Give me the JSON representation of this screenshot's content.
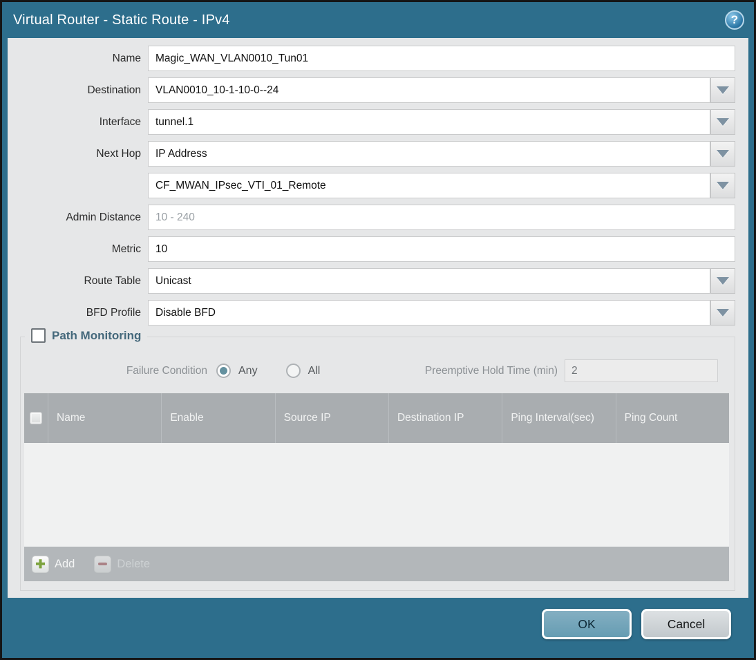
{
  "window": {
    "title": "Virtual Router - Static Route - IPv4",
    "help_glyph": "?"
  },
  "form": {
    "name": {
      "label": "Name",
      "value": "Magic_WAN_VLAN0010_Tun01"
    },
    "destination": {
      "label": "Destination",
      "value": "VLAN0010_10-1-10-0--24"
    },
    "interface": {
      "label": "Interface",
      "value": "tunnel.1"
    },
    "next_hop": {
      "label": "Next Hop",
      "value": "IP Address"
    },
    "next_hop_address": {
      "value": "CF_MWAN_IPsec_VTI_01_Remote"
    },
    "admin_distance": {
      "label": "Admin Distance",
      "placeholder": "10 - 240"
    },
    "metric": {
      "label": "Metric",
      "value": "10"
    },
    "route_table": {
      "label": "Route Table",
      "value": "Unicast"
    },
    "bfd_profile": {
      "label": "BFD Profile",
      "value": "Disable BFD"
    }
  },
  "path_monitoring": {
    "title": "Path Monitoring",
    "enabled": false,
    "failure_condition": {
      "label": "Failure Condition",
      "options": [
        "Any",
        "All"
      ],
      "selected": "Any"
    },
    "preemptive_hold_time": {
      "label": "Preemptive Hold Time (min)",
      "value": "2"
    },
    "table": {
      "columns": [
        "Name",
        "Enable",
        "Source IP",
        "Destination IP",
        "Ping Interval(sec)",
        "Ping Count"
      ],
      "rows": []
    },
    "add_label": "Add",
    "delete_label": "Delete"
  },
  "footer": {
    "ok_label": "OK",
    "cancel_label": "Cancel"
  },
  "colors": {
    "frame_teal": "#2d6e8c",
    "body_grey": "#e6e7e8",
    "header_grey": "#a9adb0",
    "ok_blue": "#6f9fb4",
    "radio_selected": "#64919f",
    "add_green": "#7da33f",
    "delete_red": "#a4595e"
  }
}
